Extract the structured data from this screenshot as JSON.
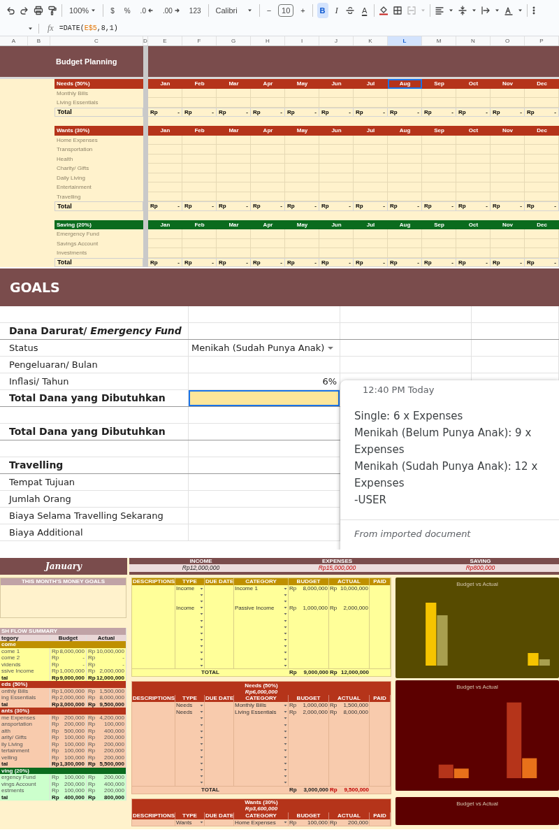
{
  "toolbar": {
    "zoom": "100%",
    "currency": "$",
    "percent": "%",
    "decimal_decrease": ".0",
    "decimal_increase": ".00",
    "number_format": "123",
    "font": "Calibri",
    "font_size_minus": "−",
    "font_size": "10",
    "font_size_plus": "+",
    "bold": {
      "label": "B",
      "selected": true
    },
    "italic": {
      "label": "I",
      "selected": false
    },
    "text_color": "A"
  },
  "formula_bar": {
    "fx": "fx",
    "formula": [
      {
        "kind": "plain",
        "text": "=DATE("
      },
      {
        "kind": "reference",
        "text": "E$5"
      },
      {
        "kind": "plain",
        "text": ",8,1)"
      }
    ]
  },
  "budget_planning": {
    "columns": [
      {
        "label": "A",
        "selected": false
      },
      {
        "label": "B",
        "selected": false
      },
      {
        "label": "C",
        "selected": false
      },
      {
        "label": "D",
        "selected": false
      },
      {
        "label": "E",
        "selected": false
      },
      {
        "label": "F",
        "selected": false
      },
      {
        "label": "G",
        "selected": false
      },
      {
        "label": "H",
        "selected": false
      },
      {
        "label": "I",
        "selected": false
      },
      {
        "label": "J",
        "selected": false
      },
      {
        "label": "K",
        "selected": false
      },
      {
        "label": "L",
        "selected": true
      },
      {
        "label": "M",
        "selected": false
      },
      {
        "label": "N",
        "selected": false
      },
      {
        "label": "O",
        "selected": false
      },
      {
        "label": "P",
        "selected": false
      }
    ],
    "title": "Budget Planning",
    "sections": [
      {
        "kind": "needs",
        "label": "Needs (50%)",
        "months": [
          {
            "label": "Jan",
            "selected": false
          },
          {
            "label": "Feb",
            "selected": false
          },
          {
            "label": "Mar",
            "selected": false
          },
          {
            "label": "Apr",
            "selected": false
          },
          {
            "label": "May",
            "selected": false
          },
          {
            "label": "Jun",
            "selected": false
          },
          {
            "label": "Jul",
            "selected": false
          },
          {
            "label": "Aug",
            "selected": true
          },
          {
            "label": "Sep",
            "selected": false
          },
          {
            "label": "Oct",
            "selected": false
          },
          {
            "label": "Nov",
            "selected": false
          },
          {
            "label": "Dec",
            "selected": false
          }
        ],
        "items": [
          "Monthly Bills",
          "Living Essentials"
        ],
        "total": {
          "label": "Total",
          "cells": [
            [
              "Rp",
              "-"
            ],
            [
              "Rp",
              "-"
            ],
            [
              "Rp",
              "-"
            ],
            [
              "Rp",
              "-"
            ],
            [
              "Rp",
              "-"
            ],
            [
              "Rp",
              "-"
            ],
            [
              "Rp",
              "-"
            ],
            [
              "Rp",
              "-"
            ],
            [
              "Rp",
              "-"
            ],
            [
              "Rp",
              "-"
            ],
            [
              "Rp",
              "-"
            ],
            [
              "Rp",
              "-"
            ]
          ]
        }
      },
      {
        "kind": "wants",
        "label": "Wants (30%)",
        "months": [
          {
            "label": "Jan",
            "selected": false
          },
          {
            "label": "Feb",
            "selected": false
          },
          {
            "label": "Mar",
            "selected": false
          },
          {
            "label": "Apr",
            "selected": false
          },
          {
            "label": "May",
            "selected": false
          },
          {
            "label": "Jun",
            "selected": false
          },
          {
            "label": "Jul",
            "selected": false
          },
          {
            "label": "Aug",
            "selected": false
          },
          {
            "label": "Sep",
            "selected": false
          },
          {
            "label": "Oct",
            "selected": false
          },
          {
            "label": "Nov",
            "selected": false
          },
          {
            "label": "Dec",
            "selected": false
          }
        ],
        "items": [
          "Home Expenses",
          "Transportation",
          "Health",
          "Charity/ Gifts",
          "Daily Living",
          "Entertainment",
          "Travelling"
        ],
        "total": {
          "label": "Total",
          "cells": [
            [
              "Rp",
              "-"
            ],
            [
              "Rp",
              "-"
            ],
            [
              "Rp",
              "-"
            ],
            [
              "Rp",
              "-"
            ],
            [
              "Rp",
              "-"
            ],
            [
              "Rp",
              "-"
            ],
            [
              "Rp",
              "-"
            ],
            [
              "Rp",
              "-"
            ],
            [
              "Rp",
              "-"
            ],
            [
              "Rp",
              "-"
            ],
            [
              "Rp",
              "-"
            ],
            [
              "Rp",
              "-"
            ]
          ]
        }
      },
      {
        "kind": "saving",
        "label": "Saving (20%)",
        "months": [
          {
            "label": "Jan",
            "selected": false
          },
          {
            "label": "Feb",
            "selected": false
          },
          {
            "label": "Mar",
            "selected": false
          },
          {
            "label": "Apr",
            "selected": false
          },
          {
            "label": "May",
            "selected": false
          },
          {
            "label": "Jun",
            "selected": false
          },
          {
            "label": "Jul",
            "selected": false
          },
          {
            "label": "Aug",
            "selected": false
          },
          {
            "label": "Sep",
            "selected": false
          },
          {
            "label": "Oct",
            "selected": false
          },
          {
            "label": "Nov",
            "selected": false
          },
          {
            "label": "Dec",
            "selected": false
          }
        ],
        "items": [
          "Emergency Fund",
          "Savings Account",
          "Investments"
        ],
        "total": {
          "label": "Total",
          "cells": [
            [
              "Rp",
              "-"
            ],
            [
              "Rp",
              "-"
            ],
            [
              "Rp",
              "-"
            ],
            [
              "Rp",
              "-"
            ],
            [
              "Rp",
              "-"
            ],
            [
              "Rp",
              "-"
            ],
            [
              "Rp",
              "-"
            ],
            [
              "Rp",
              "-"
            ],
            [
              "Rp",
              "-"
            ],
            [
              "Rp",
              "-"
            ],
            [
              "Rp",
              "-"
            ],
            [
              "Rp",
              "-"
            ]
          ]
        }
      }
    ]
  },
  "goals": {
    "title": "GOALS",
    "rows": [
      {
        "kind": "blank"
      },
      {
        "kind": "heading",
        "label": "Dana Darurat/ *Emergency Fund*",
        "selected": false
      },
      {
        "kind": "dropdown_field",
        "label": "Status",
        "value": "Menikah (Sudah Punya Anak)"
      },
      {
        "kind": "text_field",
        "label": "Pengeluaran/ Bulan"
      },
      {
        "kind": "number_field",
        "label": "Inflasi/ Tahun",
        "value": "6%"
      },
      {
        "kind": "heading",
        "label": "Total Dana yang Dibutuhkan",
        "selected": true
      },
      {
        "kind": "blank"
      },
      {
        "kind": "heading",
        "label": "Total Dana yang Dibutuhkan",
        "selected": false
      },
      {
        "kind": "blank"
      },
      {
        "kind": "heading",
        "label": "Travelling",
        "selected": false
      },
      {
        "kind": "text_field",
        "label": "Tempat Tujuan"
      },
      {
        "kind": "text_field",
        "label": "Jumlah Orang"
      },
      {
        "kind": "text_field",
        "label": "Biaya Selama Travelling Sekarang"
      },
      {
        "kind": "text_field",
        "label": "Biaya Additional"
      }
    ],
    "comment": {
      "time": "12:40 PM Today",
      "lines": [
        "Single: 6 x Expenses",
        "Menikah (Belum Punya Anak): 9 x Expenses",
        "Menikah (Sudah Punya Anak): 12 x Expenses",
        "-USER"
      ],
      "source": "From imported document"
    }
  },
  "monthly": {
    "month": "January",
    "summary": [
      {
        "label": "INCOME",
        "value": "Rp12,000,000",
        "alert": false
      },
      {
        "label": "EXPENSES",
        "value": "Rp15,000,000",
        "alert": true
      },
      {
        "label": "SAVING",
        "value": "Rp800,000",
        "alert": true
      }
    ],
    "goals_box": {
      "title": "THIS MONTH'S MONEY GOALS"
    },
    "cash_flow": {
      "title": "SH FLOW SUMMARY",
      "columns": [
        "tegory",
        "Budget",
        "Actual"
      ],
      "groups": [
        {
          "kind": "income",
          "label": "come",
          "items": [
            {
              "label": "come 1",
              "budget": [
                "Rp",
                "8,000,000"
              ],
              "actual": [
                "Rp",
                "10,000,000"
              ]
            },
            {
              "label": "come 2",
              "budget": [
                "Rp",
                "-"
              ],
              "actual": [
                "Rp",
                "-"
              ]
            },
            {
              "label": "vidends",
              "budget": [
                "Rp",
                "-"
              ],
              "actual": [
                "Rp",
                "-"
              ]
            },
            {
              "label": "ssive Income",
              "budget": [
                "Rp",
                "1,000,000"
              ],
              "actual": [
                "Rp",
                "2,000,000"
              ]
            }
          ],
          "total": {
            "label": "tal",
            "budget": [
              "Rp",
              "9,000,000"
            ],
            "actual": [
              "Rp",
              "12,000,000"
            ]
          }
        },
        {
          "kind": "needs",
          "label": "eds (50%)",
          "items": [
            {
              "label": "onthly Bills",
              "budget": [
                "Rp",
                "1,000,000"
              ],
              "actual": [
                "Rp",
                "1,500,000"
              ]
            },
            {
              "label": "ing Essentials",
              "budget": [
                "Rp",
                "2,000,000"
              ],
              "actual": [
                "Rp",
                "8,000,000"
              ]
            }
          ],
          "total": {
            "label": "tal",
            "budget": [
              "Rp",
              "3,000,000"
            ],
            "actual": [
              "Rp",
              "9,500,000"
            ]
          }
        },
        {
          "kind": "wants",
          "label": "ants (30%)",
          "items": [
            {
              "label": "me Expenses",
              "budget": [
                "Rp",
                "200,000"
              ],
              "actual": [
                "Rp",
                "4,200,000"
              ]
            },
            {
              "label": "ansportation",
              "budget": [
                "Rp",
                "200,000"
              ],
              "actual": [
                "Rp",
                "100,000"
              ]
            },
            {
              "label": "alth",
              "budget": [
                "Rp",
                "500,000"
              ],
              "actual": [
                "Rp",
                "400,000"
              ]
            },
            {
              "label": "arity/ Gifts",
              "budget": [
                "Rp",
                "100,000"
              ],
              "actual": [
                "Rp",
                "200,000"
              ]
            },
            {
              "label": "ily Living",
              "budget": [
                "Rp",
                "100,000"
              ],
              "actual": [
                "Rp",
                "200,000"
              ]
            },
            {
              "label": "tertainment",
              "budget": [
                "Rp",
                "100,000"
              ],
              "actual": [
                "Rp",
                "200,000"
              ]
            },
            {
              "label": "velling",
              "budget": [
                "Rp",
                "100,000"
              ],
              "actual": [
                "Rp",
                "200,000"
              ]
            }
          ],
          "total": {
            "label": "tal",
            "budget": [
              "Rp",
              "1,300,000"
            ],
            "actual": [
              "Rp",
              "5,500,000"
            ]
          }
        },
        {
          "kind": "saving",
          "label": "ving (20%)",
          "items": [
            {
              "label": "ergency Fund",
              "budget": [
                "Rp",
                "100,000"
              ],
              "actual": [
                "Rp",
                "200,000"
              ]
            },
            {
              "label": "vings Account",
              "budget": [
                "Rp",
                "200,000"
              ],
              "actual": [
                "Rp",
                "400,000"
              ]
            },
            {
              "label": "estments",
              "budget": [
                "Rp",
                "100,000"
              ],
              "actual": [
                "Rp",
                "200,000"
              ]
            }
          ],
          "total": {
            "label": "tal",
            "budget": [
              "Rp",
              "400,000"
            ],
            "actual": [
              "Rp",
              "800,000"
            ]
          }
        }
      ]
    },
    "tables": [
      {
        "kind": "income",
        "columns": [
          "DESCRIPTIONS",
          "TYPE",
          "DUE DATE",
          "CATEGORY",
          "BUDGET",
          "ACTUAL",
          "PAID"
        ],
        "rows": [
          {
            "kind": "entry",
            "type": "Income",
            "category": "Income 1",
            "budget": [
              "Rp",
              "8,000,000"
            ],
            "actual": [
              "Rp",
              "10,000,000"
            ]
          },
          {
            "kind": "empty"
          },
          {
            "kind": "empty"
          },
          {
            "kind": "entry",
            "type": "Income",
            "category": "Passive Income",
            "budget": [
              "Rp",
              "1,000,000"
            ],
            "actual": [
              "Rp",
              "2,000,000"
            ]
          },
          {
            "kind": "empty"
          },
          {
            "kind": "empty"
          },
          {
            "kind": "empty"
          },
          {
            "kind": "empty"
          },
          {
            "kind": "empty"
          },
          {
            "kind": "empty"
          },
          {
            "kind": "empty"
          },
          {
            "kind": "empty"
          },
          {
            "kind": "empty"
          }
        ],
        "total": {
          "label": "TOTAL",
          "budget": [
            "Rp",
            "9,000,000"
          ],
          "actual": [
            "Rp",
            "12,000,000"
          ],
          "alert": false
        }
      },
      {
        "kind": "needs",
        "title": "Needs (50%)",
        "amount": "Rp6,000,000",
        "columns": [
          "DESCRIPTIONS",
          "TYPE",
          "DUE DATE",
          "CATEGORY",
          "BUDGET",
          "ACTUAL",
          "PAID"
        ],
        "rows": [
          {
            "kind": "entry",
            "type": "Needs",
            "category": "Monthly Bills",
            "budget": [
              "Rp",
              "1,000,000"
            ],
            "actual": [
              "Rp",
              "1,500,000"
            ]
          },
          {
            "kind": "entry",
            "type": "Needs",
            "category": "Living Essentials",
            "budget": [
              "Rp",
              "2,000,000"
            ],
            "actual": [
              "Rp",
              "8,000,000"
            ]
          },
          {
            "kind": "empty"
          },
          {
            "kind": "empty"
          },
          {
            "kind": "empty"
          },
          {
            "kind": "empty"
          },
          {
            "kind": "empty"
          },
          {
            "kind": "empty"
          },
          {
            "kind": "empty"
          },
          {
            "kind": "empty"
          },
          {
            "kind": "empty"
          },
          {
            "kind": "empty"
          },
          {
            "kind": "empty"
          }
        ],
        "total": {
          "label": "TOTAL",
          "budget": [
            "Rp",
            "3,000,000"
          ],
          "actual": [
            "Rp",
            "9,500,000"
          ],
          "alert": true
        }
      },
      {
        "kind": "wants",
        "title": "Wants (30%)",
        "amount": "Rp3,600,000",
        "columns": [
          "DESCRIPTIONS",
          "TYPE",
          "DUE DATE",
          "CATEGORY",
          "BUDGET",
          "ACTUAL",
          "PAID"
        ],
        "rows": [
          {
            "kind": "entry",
            "type": "Wants",
            "category": "Home Expenses",
            "budget": [
              "Rp",
              "100,000"
            ],
            "actual": [
              "Rp",
              "200,000"
            ]
          }
        ]
      }
    ],
    "charts": [
      {
        "kind": "income",
        "title": "Budget vs Actual"
      },
      {
        "kind": "needs",
        "title": "Budget vs Actual"
      },
      {
        "kind": "wants",
        "title": "Budget vs Actual"
      }
    ]
  }
}
